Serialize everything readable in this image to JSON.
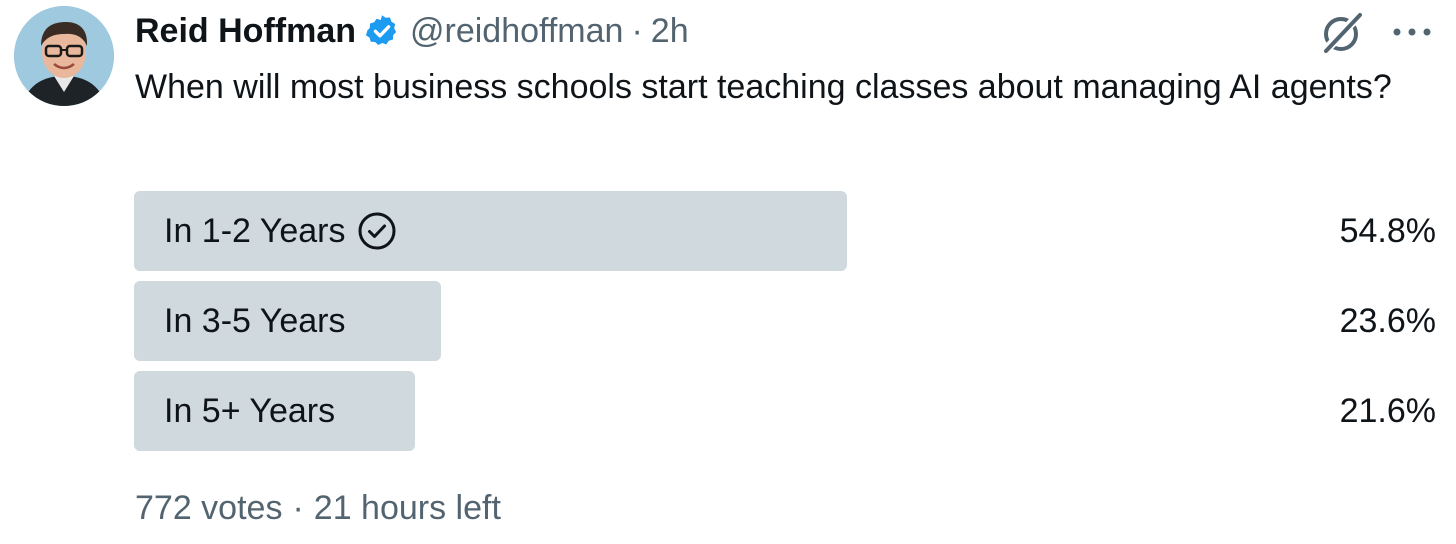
{
  "author": {
    "name": "Reid Hoffman",
    "handle": "@reidhoffman",
    "separator": "·",
    "time": "2h",
    "verified": true,
    "avatar_icon": "profile-photo"
  },
  "tweet": {
    "text": "When will most business schools start teaching classes about managing AI agents?"
  },
  "poll": {
    "options": [
      {
        "label": "In 1-2 Years",
        "percent": "54.8%",
        "fraction": 0.548,
        "selected": true
      },
      {
        "label": "In 3-5 Years",
        "percent": "23.6%",
        "fraction": 0.236,
        "selected": false
      },
      {
        "label": "In 5+ Years",
        "percent": "21.6%",
        "fraction": 0.216,
        "selected": false
      }
    ],
    "votes": "772 votes",
    "separator": "·",
    "time_left": "21 hours left"
  },
  "colors": {
    "bar": "#cfd9de",
    "verified": "#1d9bf0",
    "muted_text": "#536471",
    "text": "#0f1419"
  },
  "icons": {
    "verified": "verified-badge-icon",
    "grok": "grok-icon",
    "more": "more-icon",
    "selected_check": "check-circle-icon"
  }
}
